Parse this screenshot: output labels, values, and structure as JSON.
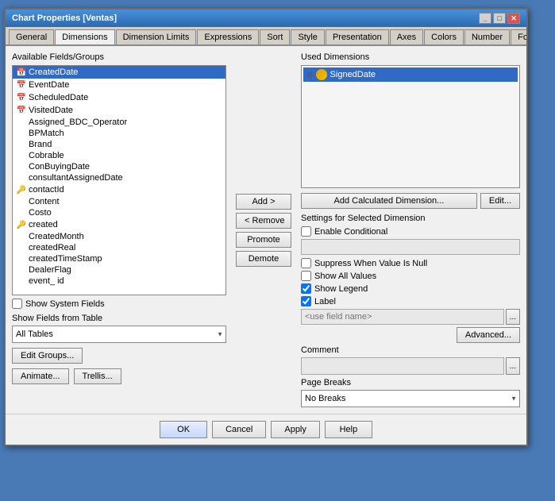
{
  "window": {
    "title": "Chart Properties [Ventas]"
  },
  "tabs": [
    {
      "label": "General",
      "active": false
    },
    {
      "label": "Dimensions",
      "active": true
    },
    {
      "label": "Dimension Limits",
      "active": false
    },
    {
      "label": "Expressions",
      "active": false
    },
    {
      "label": "Sort",
      "active": false
    },
    {
      "label": "Style",
      "active": false
    },
    {
      "label": "Presentation",
      "active": false
    },
    {
      "label": "Axes",
      "active": false
    },
    {
      "label": "Colors",
      "active": false
    },
    {
      "label": "Number",
      "active": false
    },
    {
      "label": "Font",
      "active": false
    }
  ],
  "left_panel": {
    "label": "Available Fields/Groups",
    "fields": [
      {
        "name": "CreatedDate",
        "icon": "calendar",
        "selected": true,
        "indent": 0
      },
      {
        "name": "EventDate",
        "icon": "calendar",
        "selected": false,
        "indent": 0
      },
      {
        "name": "ScheduledDate",
        "icon": "calendar",
        "selected": false,
        "indent": 0
      },
      {
        "name": "VisitedDate",
        "icon": "calendar",
        "selected": false,
        "indent": 0
      },
      {
        "name": "Assigned_BDC_Operator",
        "icon": "none",
        "selected": false,
        "indent": 1
      },
      {
        "name": "BPMatch",
        "icon": "none",
        "selected": false,
        "indent": 1
      },
      {
        "name": "Brand",
        "icon": "none",
        "selected": false,
        "indent": 1
      },
      {
        "name": "Cobrable",
        "icon": "none",
        "selected": false,
        "indent": 1
      },
      {
        "name": "ConBuyingDate",
        "icon": "none",
        "selected": false,
        "indent": 1
      },
      {
        "name": "consultantAssignedDate",
        "icon": "none",
        "selected": false,
        "indent": 1
      },
      {
        "name": "contactId",
        "icon": "key",
        "selected": false,
        "indent": 0
      },
      {
        "name": "Content",
        "icon": "none",
        "selected": false,
        "indent": 1
      },
      {
        "name": "Costo",
        "icon": "none",
        "selected": false,
        "indent": 1
      },
      {
        "name": "created",
        "icon": "key",
        "selected": false,
        "indent": 0
      },
      {
        "name": "CreatedMonth",
        "icon": "none",
        "selected": false,
        "indent": 1
      },
      {
        "name": "createdReal",
        "icon": "none",
        "selected": false,
        "indent": 1
      },
      {
        "name": "createdTimeStamp",
        "icon": "none",
        "selected": false,
        "indent": 1
      },
      {
        "name": "DealerFlag",
        "icon": "none",
        "selected": false,
        "indent": 1
      },
      {
        "name": "event_ id",
        "icon": "none",
        "selected": false,
        "indent": 1
      }
    ],
    "show_system_fields": "Show System Fields",
    "show_fields_from_table": "Show Fields from Table",
    "table_dropdown_value": "All Tables",
    "btn_edit_groups": "Edit Groups...",
    "btn_animate": "Animate...",
    "btn_trellis": "Trellis..."
  },
  "center_buttons": {
    "add": "Add >",
    "remove": "< Remove",
    "promote": "Promote",
    "demote": "Demote"
  },
  "right_panel": {
    "label": "Used Dimensions",
    "used_dims": [
      {
        "name": "SignedDate",
        "selected": true
      }
    ],
    "btn_add_calc": "Add Calculated Dimension...",
    "btn_edit": "Edit...",
    "settings_label": "Settings for Selected Dimension",
    "enable_conditional": "Enable Conditional",
    "suppress_null": "Suppress When Value Is Null",
    "show_all_values": "Show All Values",
    "show_legend": "Show Legend",
    "label_checkbox": "Label",
    "label_placeholder": "<use field name>",
    "btn_ellipsis1": "...",
    "btn_advanced": "Advanced...",
    "comment_label": "Comment",
    "btn_ellipsis2": "...",
    "page_breaks_label": "Page Breaks",
    "page_breaks_value": "No Breaks"
  },
  "bottom_buttons": {
    "ok": "OK",
    "cancel": "Cancel",
    "apply": "Apply",
    "help": "Help"
  }
}
